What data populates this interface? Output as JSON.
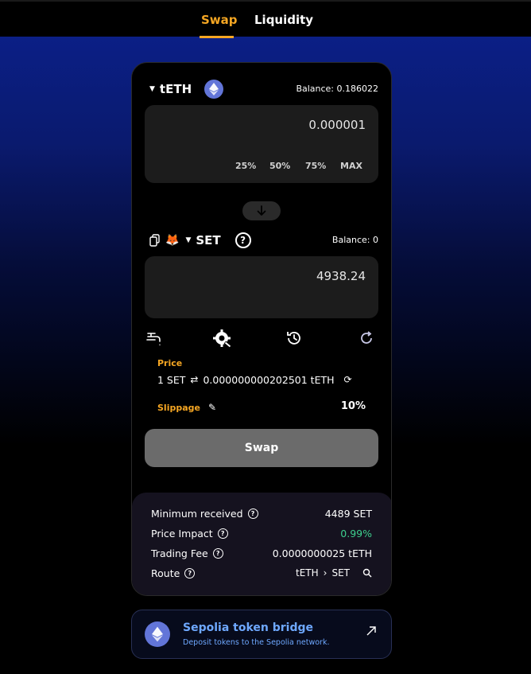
{
  "nav": {
    "tabs": [
      {
        "label": "Swap",
        "active": true
      },
      {
        "label": "Liquidity",
        "active": false
      }
    ]
  },
  "from_token": {
    "symbol": "tETH",
    "icon": "ethereum-icon",
    "balance_text": "Balance: 0.186022",
    "amount": "0.000001",
    "quick_amounts": [
      "25%",
      "50%",
      "75%",
      "MAX"
    ]
  },
  "to_token": {
    "symbol": "SET",
    "icons": [
      "copy-icon",
      "metamask-fox-icon",
      "help-circle-icon"
    ],
    "balance_text": "Balance: 0",
    "amount": "4938.24"
  },
  "tools": [
    "faucet-icon",
    "settings-gear-icon",
    "history-icon",
    "refresh-icon"
  ],
  "price": {
    "label": "Price",
    "base": "1 SET",
    "quote": "0.000000000202501 tETH"
  },
  "slippage": {
    "label": "Slippage",
    "value": "10%"
  },
  "swap_button": "Swap",
  "summary": {
    "minimum_received": {
      "label": "Minimum received",
      "value": "4489 SET"
    },
    "price_impact": {
      "label": "Price Impact",
      "value": "0.99%"
    },
    "trading_fee": {
      "label": "Trading Fee",
      "value": "0.0000000025 tETH"
    },
    "route": {
      "label": "Route",
      "from": "tETH",
      "sep": "›",
      "to": "SET"
    }
  },
  "bridge": {
    "title": "Sepolia token bridge",
    "subtitle": "Deposit tokens to the Sepolia network."
  },
  "colors": {
    "accent": "#f5a623",
    "positive": "#3ecf8e",
    "eth_purple": "#6275d8",
    "bridge_title": "#6ea8ff"
  }
}
